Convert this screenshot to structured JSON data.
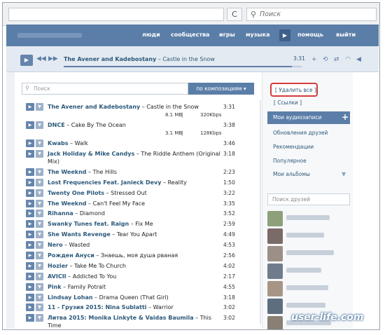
{
  "browser": {
    "search_placeholder": "Поиск",
    "reload_glyph": "C"
  },
  "nav": {
    "items": [
      "люди",
      "сообщества",
      "игры",
      "музыка",
      "помощь",
      "выйти"
    ]
  },
  "player": {
    "artist": "The Avener and Kadebostany",
    "separator": " – ",
    "title": "Castle in the Snow",
    "time": "3:31",
    "progress_fraction": 0.96
  },
  "search": {
    "placeholder": "Поиск",
    "filter_label": "по композициям ▾"
  },
  "tracks": [
    {
      "artist": "The Avener and Kadebostany",
      "title": "Castle in the Snow",
      "size": "8.1 MB",
      "bitrate": "320Kbps",
      "duration": "3:31"
    },
    {
      "artist": "DNCE",
      "title": "Cake By The Ocean",
      "size": "3.1 MB",
      "bitrate": "128Kbps",
      "duration": "3:38"
    },
    {
      "artist": "Kwabs",
      "title": "Walk",
      "duration": "3:46"
    },
    {
      "artist": "Jack Holiday & Mike Candys",
      "title": "The Riddle Anthem (Original Mix)",
      "duration": "3:18"
    },
    {
      "artist": "The Weeknd",
      "title": "The Hills",
      "duration": "2:23"
    },
    {
      "artist": "Lost Frequencies Feat. Janieck Devy",
      "title": "Reality",
      "duration": "1:50"
    },
    {
      "artist": "Twenty One Pilots",
      "title": "Stressed Out",
      "duration": "3:22"
    },
    {
      "artist": "The Weeknd",
      "title": "Can't Feel My Face",
      "duration": "3:35"
    },
    {
      "artist": "Rihanna",
      "title": "Diamond",
      "duration": "3:52"
    },
    {
      "artist": "Swanky Tunes feat. Raign",
      "title": "Fix Me",
      "duration": "2:59"
    },
    {
      "artist": "She Wants Revenge",
      "title": "Tear You Apart",
      "duration": "4:49"
    },
    {
      "artist": "Nero",
      "title": "Wasted",
      "duration": "4:53"
    },
    {
      "artist": "Рожден Ануси",
      "title": "Знаешь, моя душа рваная",
      "duration": "2:56"
    },
    {
      "artist": "Hozier",
      "title": "Take Me To Church",
      "duration": "4:02"
    },
    {
      "artist": "AVICII",
      "title": "Addicted To You",
      "duration": "2:17"
    },
    {
      "artist": "Pink",
      "title": "Family Potrait",
      "duration": "4:55"
    },
    {
      "artist": "Lindsay Lohan",
      "title": "Drama Queen (That Girl)",
      "duration": "3:18"
    },
    {
      "artist": "11 - Грузия 2015: Nina Sublatti",
      "title": "Warrior",
      "duration": "3:02"
    },
    {
      "artist": "Литва 2015: Monika Linkyte & Vaidas Baumila",
      "title": "This Time",
      "duration": "3:02"
    }
  ],
  "sidebar": {
    "delete_all": "[ Удалить все ]",
    "links": "[ Ссылки ]",
    "my_audio": "Мои аудиозаписи",
    "add_glyph": "+",
    "items": [
      "Обновления друзей",
      "Рекомендации",
      "Популярное",
      "Мои альбомы"
    ],
    "friends_search_placeholder": "Поиск друзей"
  },
  "watermark": "user-life.com"
}
